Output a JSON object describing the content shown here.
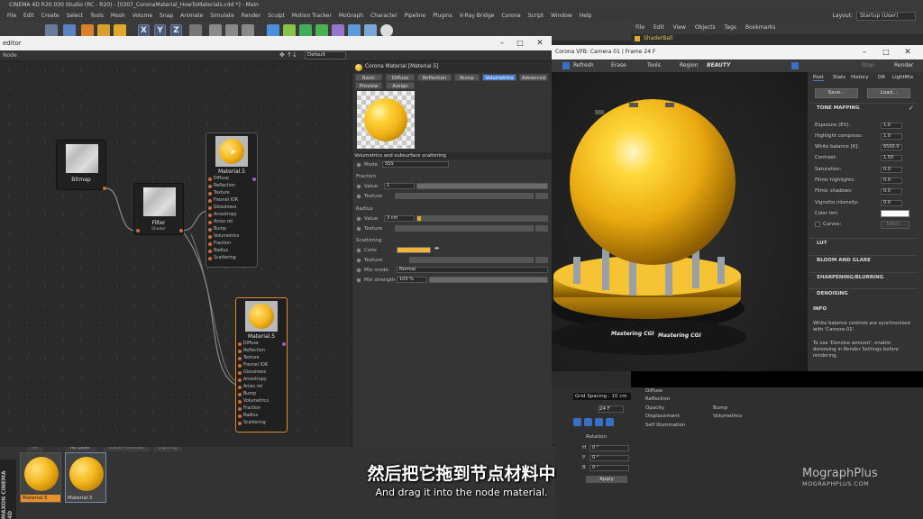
{
  "app": {
    "window_title": "CINEMA 4D R20.030 Studio (RC - R20) - [0307_CoronaMaterial_HowToMaterials.c4d *] - Main",
    "menu": [
      "File",
      "Edit",
      "Create",
      "Select",
      "Tools",
      "Mesh",
      "Volume",
      "Snap",
      "Animate",
      "Simulate",
      "Render",
      "Sculpt",
      "Motion Tracker",
      "MoGraph",
      "Character",
      "Pipeline",
      "Plugins",
      "V-Ray Bridge",
      "Corona",
      "Script",
      "Window",
      "Help"
    ],
    "layout_label": "Layout:",
    "layout_value": "Startup (User)",
    "axis_buttons": [
      "X",
      "Y",
      "Z"
    ]
  },
  "objects_panel": {
    "menu": [
      "File",
      "Edit",
      "View",
      "Objects",
      "Tags",
      "Bookmarks"
    ],
    "object_name": "ShaderBall"
  },
  "node_editor": {
    "title": "editor",
    "subbar_label": "Node",
    "subbar_select": "Default",
    "nodes": {
      "bitmap": {
        "title": "Bitmap"
      },
      "filter": {
        "title": "Filter",
        "port": "Shader"
      },
      "material_top": {
        "title": "Material.5",
        "ports": [
          "Diffuse",
          "Reflection",
          "Texture",
          "Fresnel IOR",
          "Glossiness",
          "Anisotropy",
          "Aniso rot",
          "Bump",
          "Volumetrics",
          "Fraction",
          "Radius",
          "Scattering"
        ]
      },
      "material_bottom": {
        "title": "Material.5",
        "ports": [
          "Diffuse",
          "Reflection",
          "Texture",
          "Fresnel IOR",
          "Glossiness",
          "Anisotropy",
          "Aniso rot",
          "Bump",
          "Volumetrics",
          "Fraction",
          "Radius",
          "Scattering"
        ]
      }
    }
  },
  "material_editor": {
    "header": "Corona Material [Material.5]",
    "tabs_row1": [
      "Basic",
      "Diffuse",
      "Reflection",
      "Bump",
      "Volumetrics",
      "Advanced"
    ],
    "tabs_row2": [
      "Preview",
      "Assign"
    ],
    "active_tab": "Volumetrics",
    "section": "Volumetrics and subsurface scattering",
    "mode_label": "Mode",
    "mode_value": "SSS",
    "fraction_label": "Fraction",
    "value_label": "Value",
    "fraction_value": "1",
    "texture_label": "Texture",
    "radius_label": "Radius",
    "radius_value": "3 cm",
    "scattering_label": "Scattering",
    "color_label": "Color",
    "mixmode_label": "Mix mode",
    "mixmode_value": "Normal",
    "mixstrength_label": "Mix strength",
    "mixstrength_value": "100 %"
  },
  "render_view": {
    "title": "Corona VFB: Camera 01 | Frame 24 F",
    "toolbar": {
      "refresh": "Refresh",
      "erase": "Erase",
      "tools": "Tools",
      "region": "Region",
      "beauty": "BEAUTY",
      "stop": "Stop",
      "render": "Render"
    },
    "side_tabs": [
      "Post",
      "Stats",
      "History",
      "DR",
      "LightMix"
    ],
    "save_btn": "Save...",
    "load_btn": "Load...",
    "tone_mapping": "TONE MAPPING",
    "params": [
      {
        "label": "Exposure (EV):",
        "value": "1.0"
      },
      {
        "label": "Highlight compress:",
        "value": "1.0"
      },
      {
        "label": "White balance [K]:",
        "value": "6500.0"
      },
      {
        "label": "Contrast:",
        "value": "1.50"
      },
      {
        "label": "Saturation:",
        "value": "0.0"
      },
      {
        "label": "Filmic highlights:",
        "value": "0.0"
      },
      {
        "label": "Filmic shadows:",
        "value": "0.0"
      },
      {
        "label": "Vignette intensity:",
        "value": "0.0"
      }
    ],
    "color_tint": "Color tint:",
    "curves": "Curves:",
    "curves_btn": "Editor...",
    "sections": [
      "LUT",
      "BLOOM AND GLARE",
      "SHARPENING/BLURRING",
      "DENOISING"
    ],
    "info_title": "INFO",
    "info_text1": "White balance controls are synchronized with 'Camera 01'.",
    "info_text2": "To use 'Denoise amount', enable denoising in Render Settings before rendering.",
    "ball_text": "Mastering CGI"
  },
  "attributes": {
    "left": [
      "Diffuse",
      "Reflection",
      "Opacity",
      "Displacement",
      "Self Illumination"
    ],
    "right": [
      "Bump",
      "Volumetrics"
    ],
    "grid_spacing": "Grid Spacing : 10 cm",
    "frame": "24 F",
    "rotation": "Rotation",
    "apply": "Apply",
    "h": "H",
    "p": "P",
    "b": "B",
    "deg": "0 °"
  },
  "material_manager": {
    "tabs": [
      "All",
      "No Layer",
      "Scene Materials",
      "Lighting"
    ],
    "swatches": [
      "Material.5",
      "Material.5"
    ]
  },
  "subtitles": {
    "cn": "然后把它拖到节点材料中",
    "en": "And drag it into the node material."
  },
  "brand": {
    "line1": "MographPlus",
    "line2": "MOGRAPHPLUS.COM",
    "maxon": "MAXON CINEMA 4D"
  }
}
